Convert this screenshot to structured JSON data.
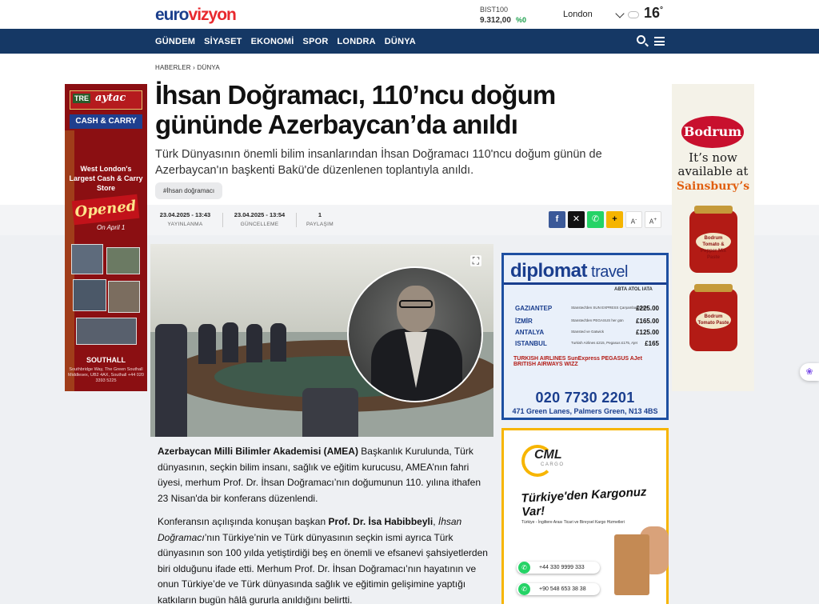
{
  "header": {
    "logo_euro": "euro",
    "logo_vizyon": "vizyon",
    "bist_label": "BIST100",
    "bist_value": "9.312,00",
    "bist_change": "%0",
    "city": "London",
    "temp": "16",
    "temp_unit": "°"
  },
  "nav": {
    "items": [
      "GÜNDEM",
      "SİYASET",
      "EKONOMİ",
      "SPOR",
      "LONDRA",
      "DÜNYA"
    ]
  },
  "breadcrumb": {
    "home": "HABERLER",
    "sep": "›",
    "section": "DÜNYA"
  },
  "article": {
    "title": "İhsan Doğramacı, 110’ncu doğum gününde Azerbaycan’da anıldı",
    "summary": "Türk Dünyasının önemli bilim insanlarından İhsan Doğramacı 110'ncu doğum günün de Azerbaycan'ın başkenti Bakü'de düzenlenen toplantıyla anıldı.",
    "tag": "#İhsan doğramacı",
    "published": "23.04.2025 - 13:43",
    "published_label": "YAYINLANMA",
    "updated": "23.04.2025 - 13:54",
    "updated_label": "GÜNCELLEME",
    "shares": "1",
    "shares_label": "PAYLAŞIM",
    "p1_bold": "Azerbaycan Milli Bilimler Akademisi (AMEA)",
    "p1_rest": " Başkanlık Kurulunda, Türk dünyasının, seçkin bilim insanı, sağlık ve eğitim kurucusu, AMEA’nın fahri üyesi, merhum Prof. Dr. İhsan Doğramacı’nın doğumunun 110. yılına ithafen 23 Nisan'da bir konferans düzenlendi.",
    "p2_a": "Konferansın  açılışında konuşan  başkan ",
    "p2_bold": "Prof. Dr. İsa Habibbeyli",
    "p2_b": ", ",
    "p2_italic": " İhsan Doğramacı",
    "p2_c": "’nın Türkiye’nin ve Türk dünyasının seçkin ismi ayrıca Türk dünyasının son 100 yılda yetiştirdiği beş en önemli ve efsanevi şahsiyetlerden  biri olduğunu ifade etti. Merhum Prof. Dr. İhsan Doğramacı’nın hayatının ve onun Türkiye’de ve Türk dünyasında sağlık ve eğitimin gelişimine yaptığı katkıların bugün hâlâ gururla anıldığını belirtti."
  },
  "share": {
    "facebook": "f",
    "x": "✕",
    "whatsapp": "✆",
    "more": "+",
    "font_down": "A",
    "font_down_sup": "-",
    "font_up": "A",
    "font_up_sup": "+"
  },
  "ads": {
    "left": {
      "tre": "TRE",
      "aytac": "aytac",
      "cash": "CASH & CARRY",
      "headline": "West London's Largest Cash & Carry Store",
      "opened": "Opened",
      "april": "On April 1",
      "south": "SOUTHALL",
      "addr": "Southbridge Way, The Green Southall Middlesex, UB2 4AX, Southall +44 020 3393 5225"
    },
    "right": {
      "bodrum": "Bodrum",
      "now": "It’s now available at",
      "sains": "Sainsbury’s",
      "jar1": "Bodrum Tomato & Pepper Mix Paste",
      "jar2": "Bodrum Tomato Paste"
    },
    "diplomat": {
      "name_bold": "diplomat",
      "name_rest": " travel",
      "abta": "ABTA  ATOL  IATA",
      "routes": [
        {
          "city": "GAZIANTEP",
          "note": "Stansted'den SUN EXPRESS Çarşamba günleri",
          "price": "£225.00"
        },
        {
          "city": "İZMİR",
          "note": "Stansted'den PEGASUS her gün",
          "price": "£165.00"
        },
        {
          "city": "ANTALYA",
          "note": "Stansted ve Gatwick",
          "price": "£125.00"
        },
        {
          "city": "ISTANBUL",
          "note": "Turkish Airlines £215, Pegasus £175, Ajet",
          "price": "£165"
        }
      ],
      "airlines": "TURKISH AIRLINES   SunExpress   PEGASUS   AJet   BRITISH AIRWAYS   WIZZ",
      "phone": "020 7730 2201",
      "address": "471 Green Lanes, Palmers Green, N13 4BS"
    },
    "cml": {
      "brand": "CML",
      "cargo": "CARGO",
      "headline": "Türkiye'den Kargonuz Var!",
      "sub": "Türkiye - İngiltere Arası Ticari ve Bireysel Kargo Hizmetleri",
      "phone1": "+44 330 9999 333",
      "phone2": "+90 548 653 38 38"
    }
  },
  "colors": {
    "nav_bg": "#153865",
    "brand_blue": "#1b3f8c",
    "brand_red": "#e8292e",
    "facebook": "#3b5998",
    "x": "#111111",
    "whatsapp": "#25d366",
    "more": "#f5b400"
  }
}
